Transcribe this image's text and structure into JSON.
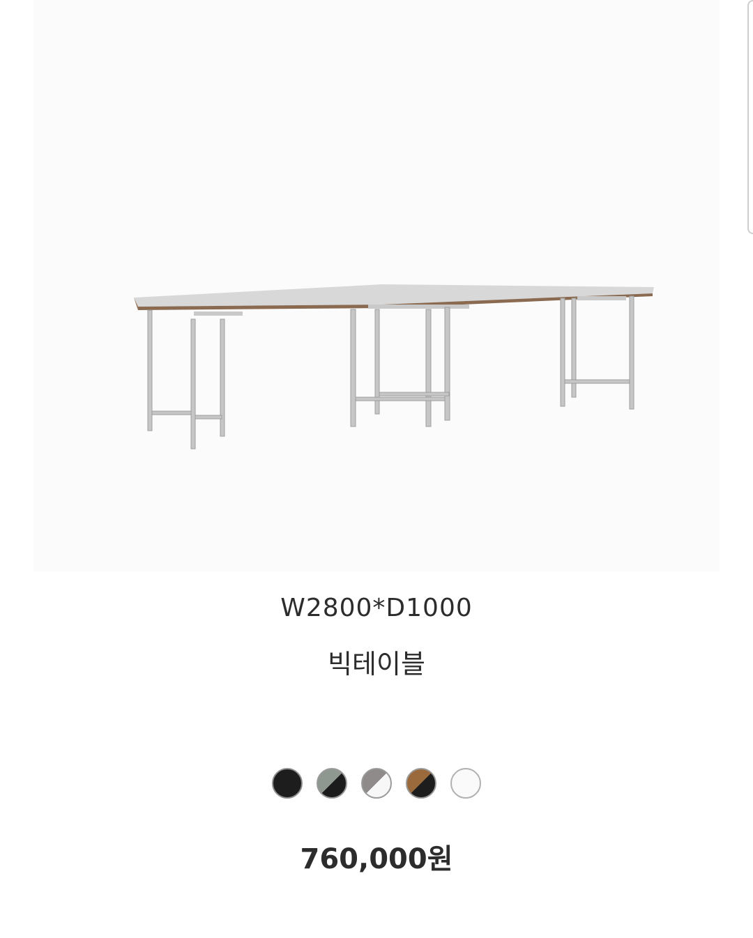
{
  "product": {
    "dimension": "W2800*D1000",
    "name": "빅테이블",
    "price": "760,000원"
  },
  "swatches": [
    {
      "name": "black",
      "colors": [
        "#1d1d1d"
      ]
    },
    {
      "name": "sage-black",
      "colors": [
        "#8f9890",
        "#1c1c1c"
      ]
    },
    {
      "name": "grey-white",
      "colors": [
        "#8e8b8a",
        "#f7f7f7"
      ]
    },
    {
      "name": "wood-black",
      "colors": [
        "#9b6a3c",
        "#1d1d1d"
      ]
    },
    {
      "name": "white",
      "colors": [
        "#fafafa"
      ]
    }
  ]
}
